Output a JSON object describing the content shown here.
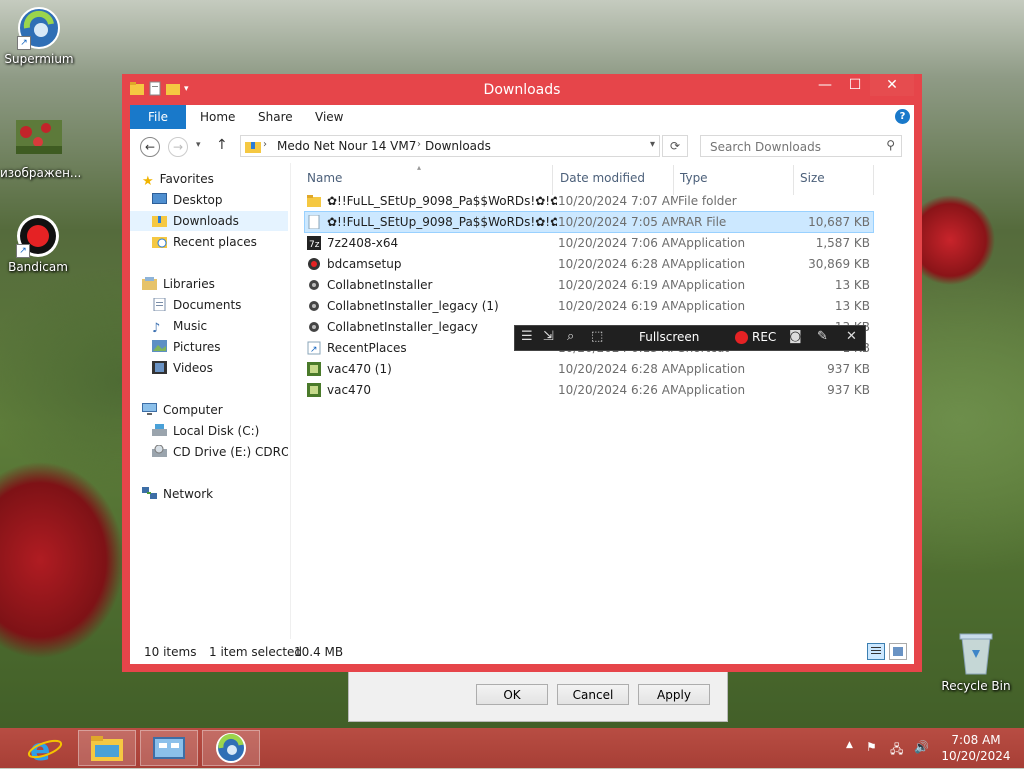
{
  "desktop": {
    "icons": [
      {
        "label": "Supermium"
      },
      {
        "label": "изображен..."
      },
      {
        "label": "Bandicam"
      }
    ],
    "recycle_bin": "Recycle Bin"
  },
  "behind_dialog": {
    "ok": "OK",
    "cancel": "Cancel",
    "apply": "Apply"
  },
  "window": {
    "title": "Downloads",
    "ribbon_tabs": [
      "File",
      "Home",
      "Share",
      "View"
    ],
    "help": "?",
    "breadcrumb": [
      "Medo Net Nour 14 VM7",
      "Downloads"
    ],
    "search_placeholder": "Search Downloads"
  },
  "nav": {
    "favorites": "Favorites",
    "desktop": "Desktop",
    "downloads": "Downloads",
    "recent_places": "Recent places",
    "libraries": "Libraries",
    "documents": "Documents",
    "music": "Music",
    "pictures": "Pictures",
    "videos": "Videos",
    "computer": "Computer",
    "local_disk": "Local Disk (C:)",
    "cd_drive": "CD Drive (E:) CDROM",
    "network": "Network"
  },
  "columns": {
    "name": "Name",
    "date": "Date modified",
    "type": "Type",
    "size": "Size"
  },
  "files": [
    {
      "name": "✿!!FuLL_SEtUp_9098_Pa$$WoRDs!✿!✿✿",
      "date": "10/20/2024 7:07 AM",
      "type": "File folder",
      "size": "",
      "icon": "folder-icon"
    },
    {
      "name": "✿!!FuLL_SEtUp_9098_Pa$$WoRDs!✿!✿✿....",
      "date": "10/20/2024 7:05 AM",
      "type": "RAR File",
      "size": "10,687 KB",
      "icon": "rar-file-icon"
    },
    {
      "name": "7z2408-x64",
      "date": "10/20/2024 7:06 AM",
      "type": "Application",
      "size": "1,587 KB",
      "icon": "7zip-icon"
    },
    {
      "name": "bdcamsetup",
      "date": "10/20/2024 6:28 AM",
      "type": "Application",
      "size": "30,869 KB",
      "icon": "bandicam-setup-icon"
    },
    {
      "name": "CollabnetInstaller",
      "date": "10/20/2024 6:19 AM",
      "type": "Application",
      "size": "13 KB",
      "icon": "installer-icon"
    },
    {
      "name": "CollabnetInstaller_legacy (1)",
      "date": "10/20/2024 6:19 AM",
      "type": "Application",
      "size": "13 KB",
      "icon": "installer-icon"
    },
    {
      "name": "CollabnetInstaller_legacy",
      "date": "",
      "type": "",
      "size": "13 KB",
      "icon": "installer-icon"
    },
    {
      "name": "RecentPlaces",
      "date": "10/20/2024 6:13 AM",
      "type": "Shortcut",
      "size": "1 KB",
      "icon": "shortcut-icon"
    },
    {
      "name": "vac470 (1)",
      "date": "10/20/2024 6:28 AM",
      "type": "Application",
      "size": "937 KB",
      "icon": "vac-icon"
    },
    {
      "name": "vac470",
      "date": "10/20/2024 6:26 AM",
      "type": "Application",
      "size": "937 KB",
      "icon": "vac-icon"
    }
  ],
  "status": {
    "items": "10 items",
    "selected": "1 item selected",
    "size": "10.4 MB"
  },
  "bandicam": {
    "fullscreen": "Fullscreen",
    "rec": "REC"
  },
  "taskbar": {
    "time": "7:08 AM",
    "date": "10/20/2024"
  }
}
